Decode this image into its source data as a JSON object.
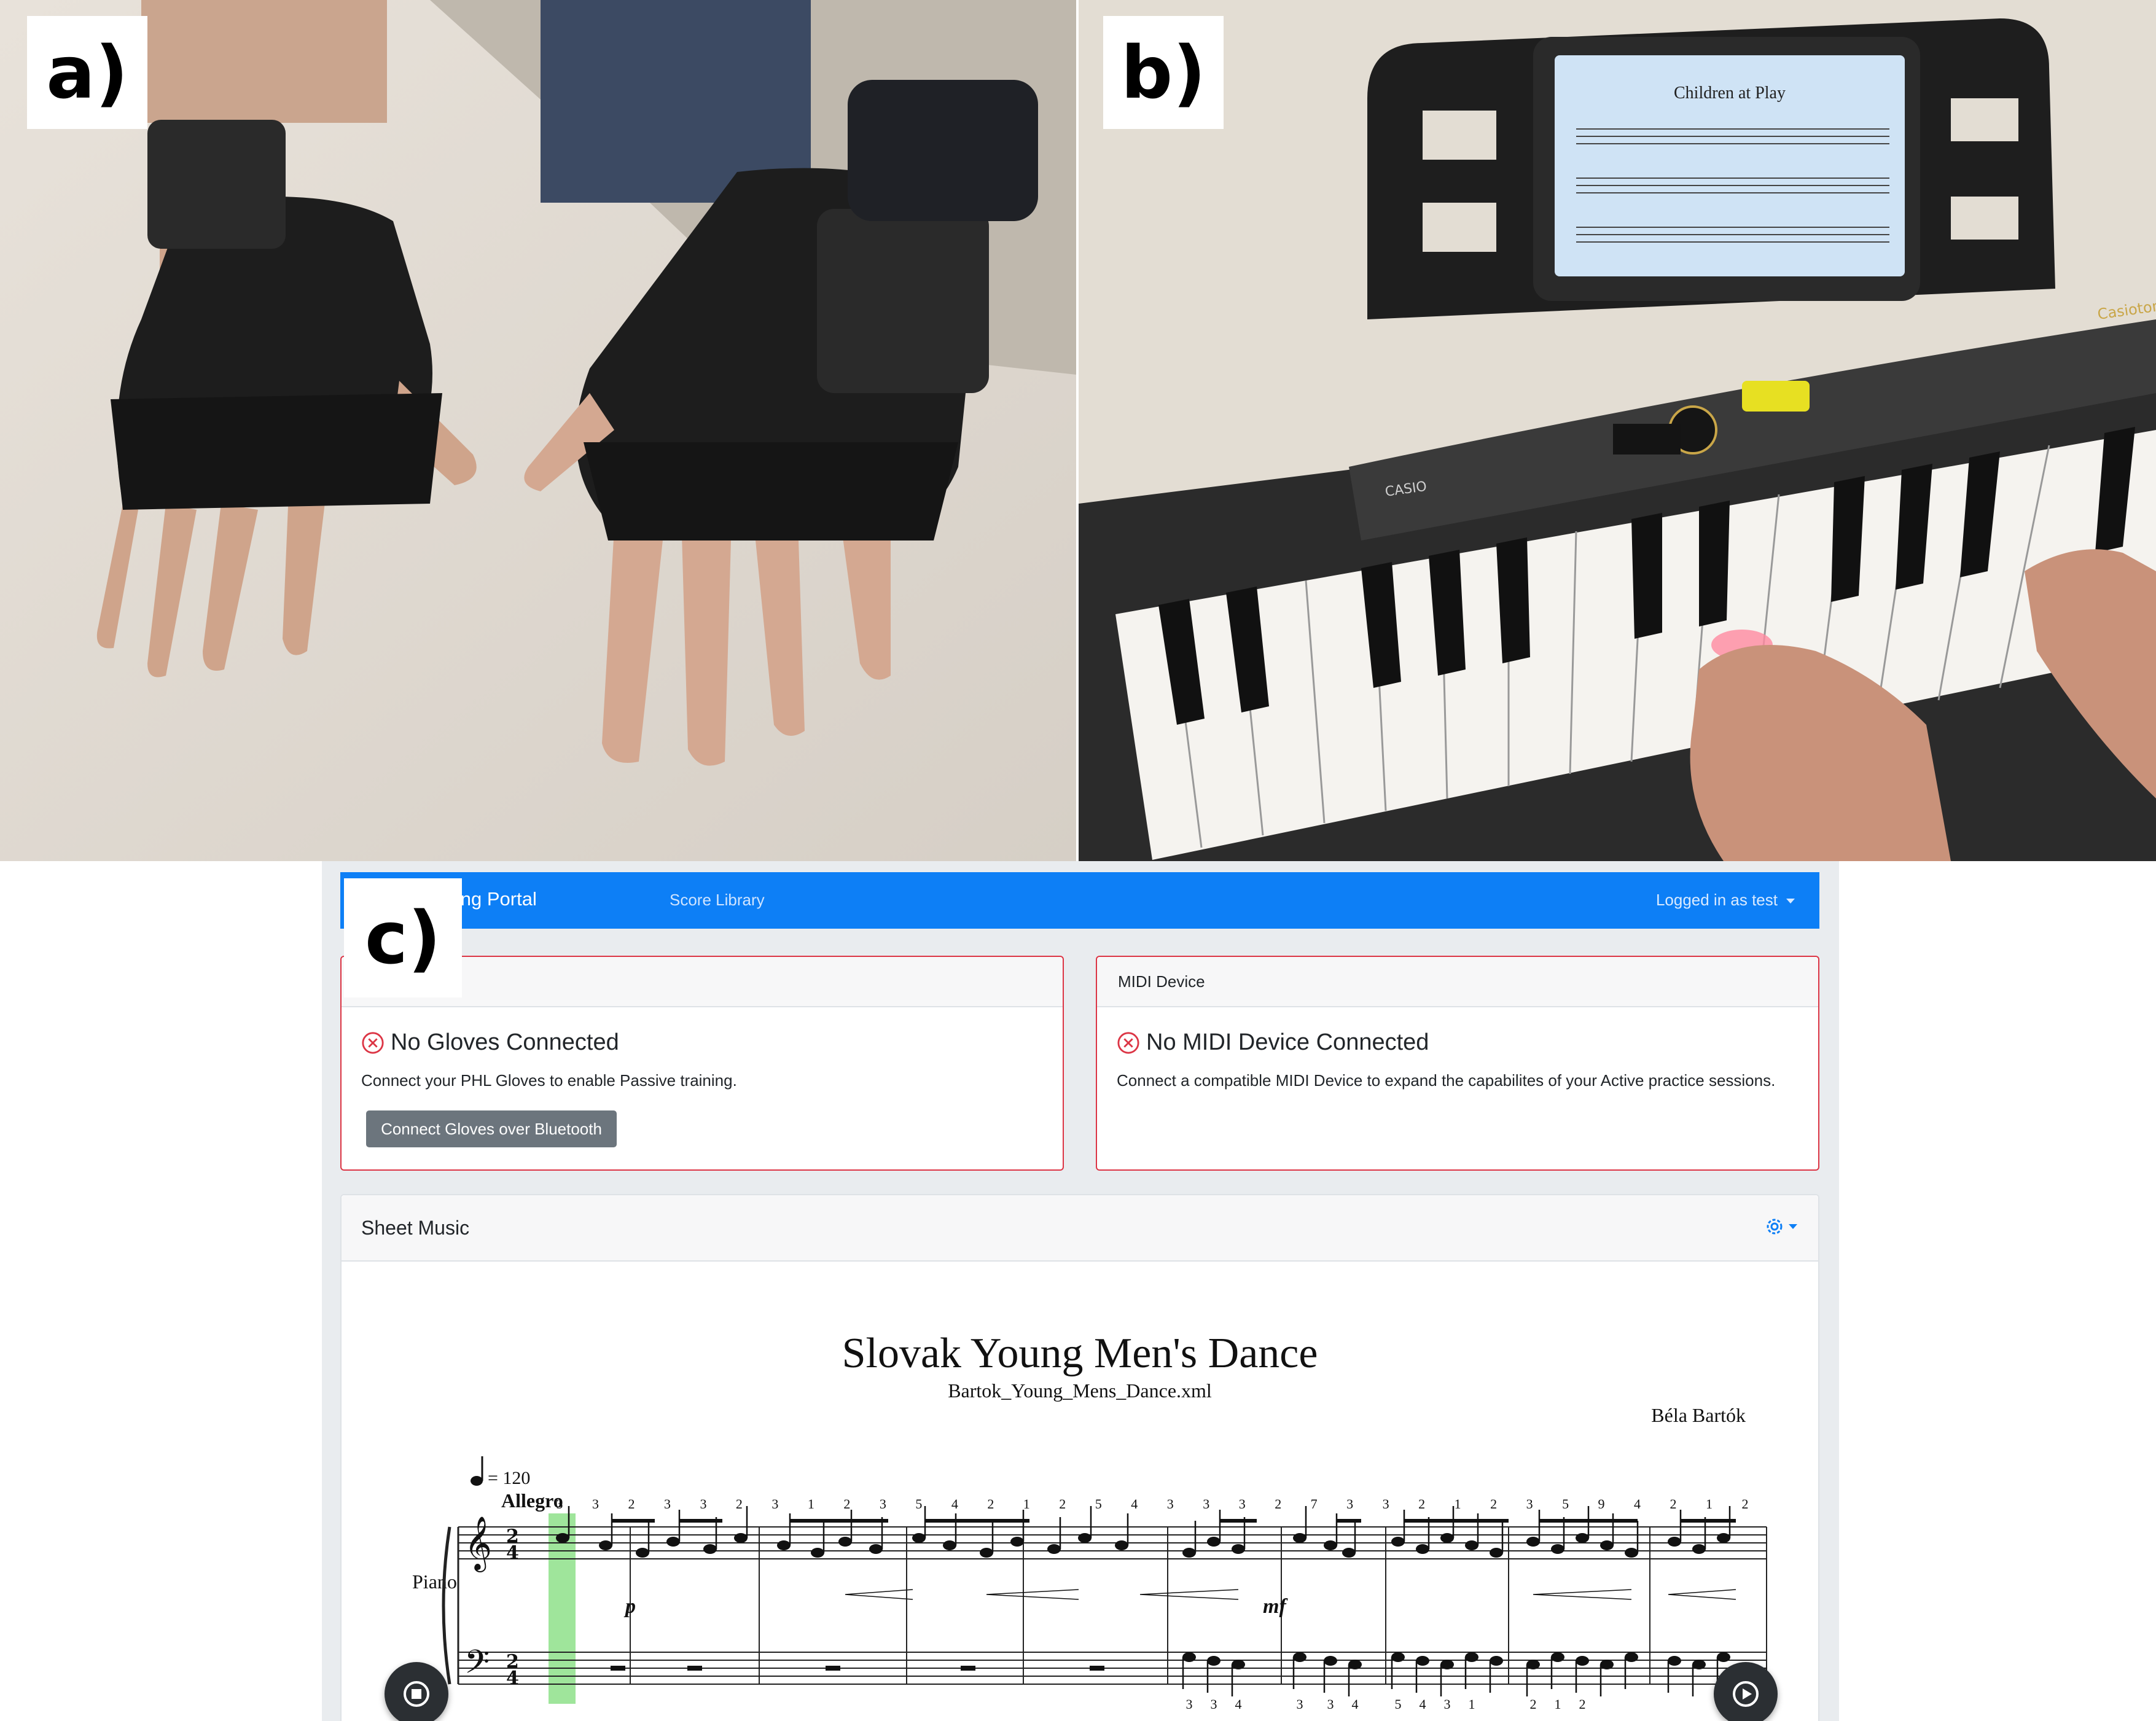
{
  "panels": {
    "a": {
      "label": "a)"
    },
    "b": {
      "label": "b)",
      "tablet_title": "Children at Play",
      "keyboard_brand": "CASIO",
      "keyboard_model": "Casiotone"
    },
    "c": {
      "label": "c)"
    }
  },
  "portal": {
    "brand": "tic Learning Portal",
    "nav_link": "Score Library",
    "user_menu": "Logged in as test"
  },
  "gloves_card": {
    "header": "",
    "title": "No Gloves Connected",
    "description": "Connect your PHL Gloves to enable Passive training.",
    "button": "Connect Gloves over Bluetooth"
  },
  "midi_card": {
    "header": "MIDI Device",
    "title": "No MIDI Device Connected",
    "description": "Connect a compatible MIDI Device to expand the capabilites of your Active practice sessions."
  },
  "sheet_music": {
    "header": "Sheet Music",
    "title": "Slovak Young Men's Dance",
    "file": "Bartok_Young_Mens_Dance.xml",
    "composer": "Béla Bartók",
    "tempo": "= 120",
    "tempo_marking": "Allegro",
    "instrument": "Piano",
    "dynamics": [
      "p",
      "mf"
    ],
    "time_signature": "2/4",
    "fingering_upper": [
      "3",
      "3",
      "2",
      "3",
      "3",
      "2",
      "3",
      "1",
      "2",
      "3",
      "5",
      "4",
      "2",
      "1",
      "2",
      "5",
      "4",
      "3",
      "3",
      "3",
      "2",
      "7",
      "3",
      "3",
      "2",
      "1",
      "2",
      "3",
      "5",
      "9",
      "4",
      "2",
      "1",
      "2"
    ],
    "fingering_lower": [
      "3",
      "3",
      "4",
      "3",
      "3",
      "4",
      "5",
      "4",
      "3",
      "1",
      "2",
      "1",
      "2"
    ],
    "icons": {
      "settings": "gear-icon",
      "stop": "stop-icon",
      "play": "play-icon",
      "status": "error-circle-icon"
    },
    "colors": {
      "highlight": "#8ee08a",
      "accent": "#0d7ff6",
      "error": "#dc3545"
    }
  }
}
